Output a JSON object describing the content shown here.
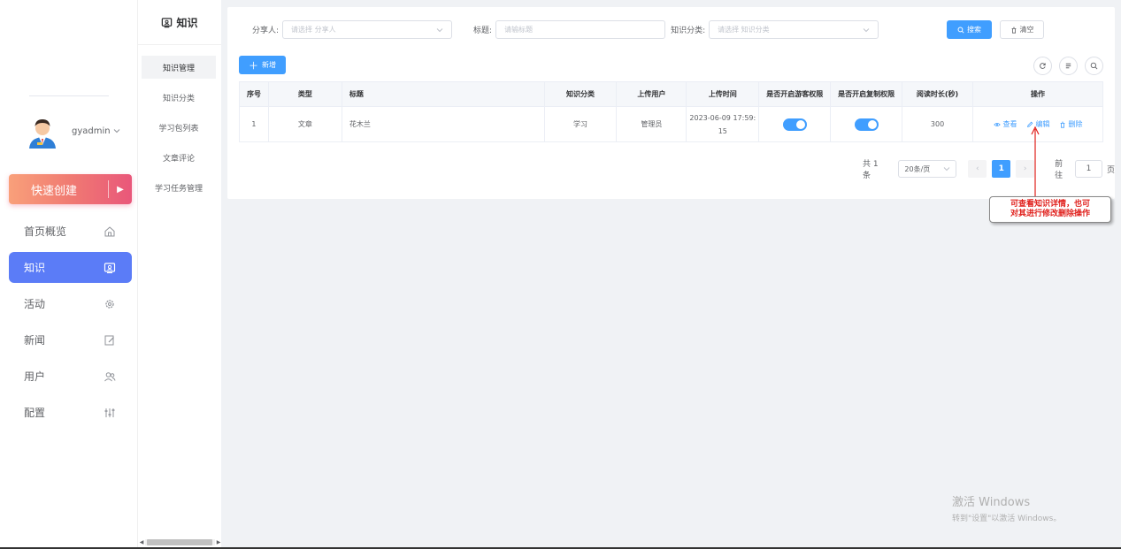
{
  "sidebar": {
    "username": "gyadmin",
    "quick_create": "快速创建",
    "items": [
      {
        "label": "首页概览",
        "icon": "home-icon",
        "active": false
      },
      {
        "label": "知识",
        "icon": "knowledge-icon",
        "active": true
      },
      {
        "label": "活动",
        "icon": "gear-icon",
        "active": false
      },
      {
        "label": "新闻",
        "icon": "edit-icon",
        "active": false
      },
      {
        "label": "用户",
        "icon": "users-icon",
        "active": false
      },
      {
        "label": "配置",
        "icon": "sliders-icon",
        "active": false
      }
    ]
  },
  "submenu": {
    "title": "知识",
    "items": [
      "知识管理",
      "知识分类",
      "学习包列表",
      "文章评论",
      "学习任务管理"
    ]
  },
  "filters": {
    "sharer_label": "分享人:",
    "sharer_placeholder": "请选择 分享人",
    "title_label": "标题:",
    "title_placeholder": "请输标题",
    "category_label": "知识分类:",
    "category_placeholder": "请选择 知识分类",
    "search_btn": "搜索",
    "clear_btn": "清空"
  },
  "toolbar": {
    "new_btn": "新增"
  },
  "table": {
    "headers": [
      "序号",
      "类型",
      "标题",
      "知识分类",
      "上传用户",
      "上传时间",
      "是否开启游客权限",
      "是否开启复制权限",
      "阅读时长(秒)",
      "操作"
    ],
    "rows": [
      {
        "index": "1",
        "type": "文章",
        "title": "花木兰",
        "category": "学习",
        "uploader": "管理员",
        "time_line1": "2023-06-09 17:59:",
        "time_line2": "15",
        "guest_enabled": true,
        "copy_enabled": true,
        "read_seconds": "300",
        "op_view": "查看",
        "op_edit": "编辑",
        "op_delete": "删除"
      }
    ]
  },
  "pagination": {
    "total": "共 1 条",
    "page_size": "20条/页",
    "current_page": "1",
    "goto_label": "前往",
    "goto_value": "1",
    "page_unit": "页"
  },
  "annotation": {
    "line1": "可查看知识详情，也可",
    "line2": "对其进行修改删除操作"
  },
  "watermark": {
    "line1": "激活 Windows",
    "line2": "转到\"设置\"以激活 Windows。"
  },
  "colors": {
    "primary": "#409eff",
    "nav_active": "#5b7cf7",
    "annotation_text": "#e0201c"
  }
}
